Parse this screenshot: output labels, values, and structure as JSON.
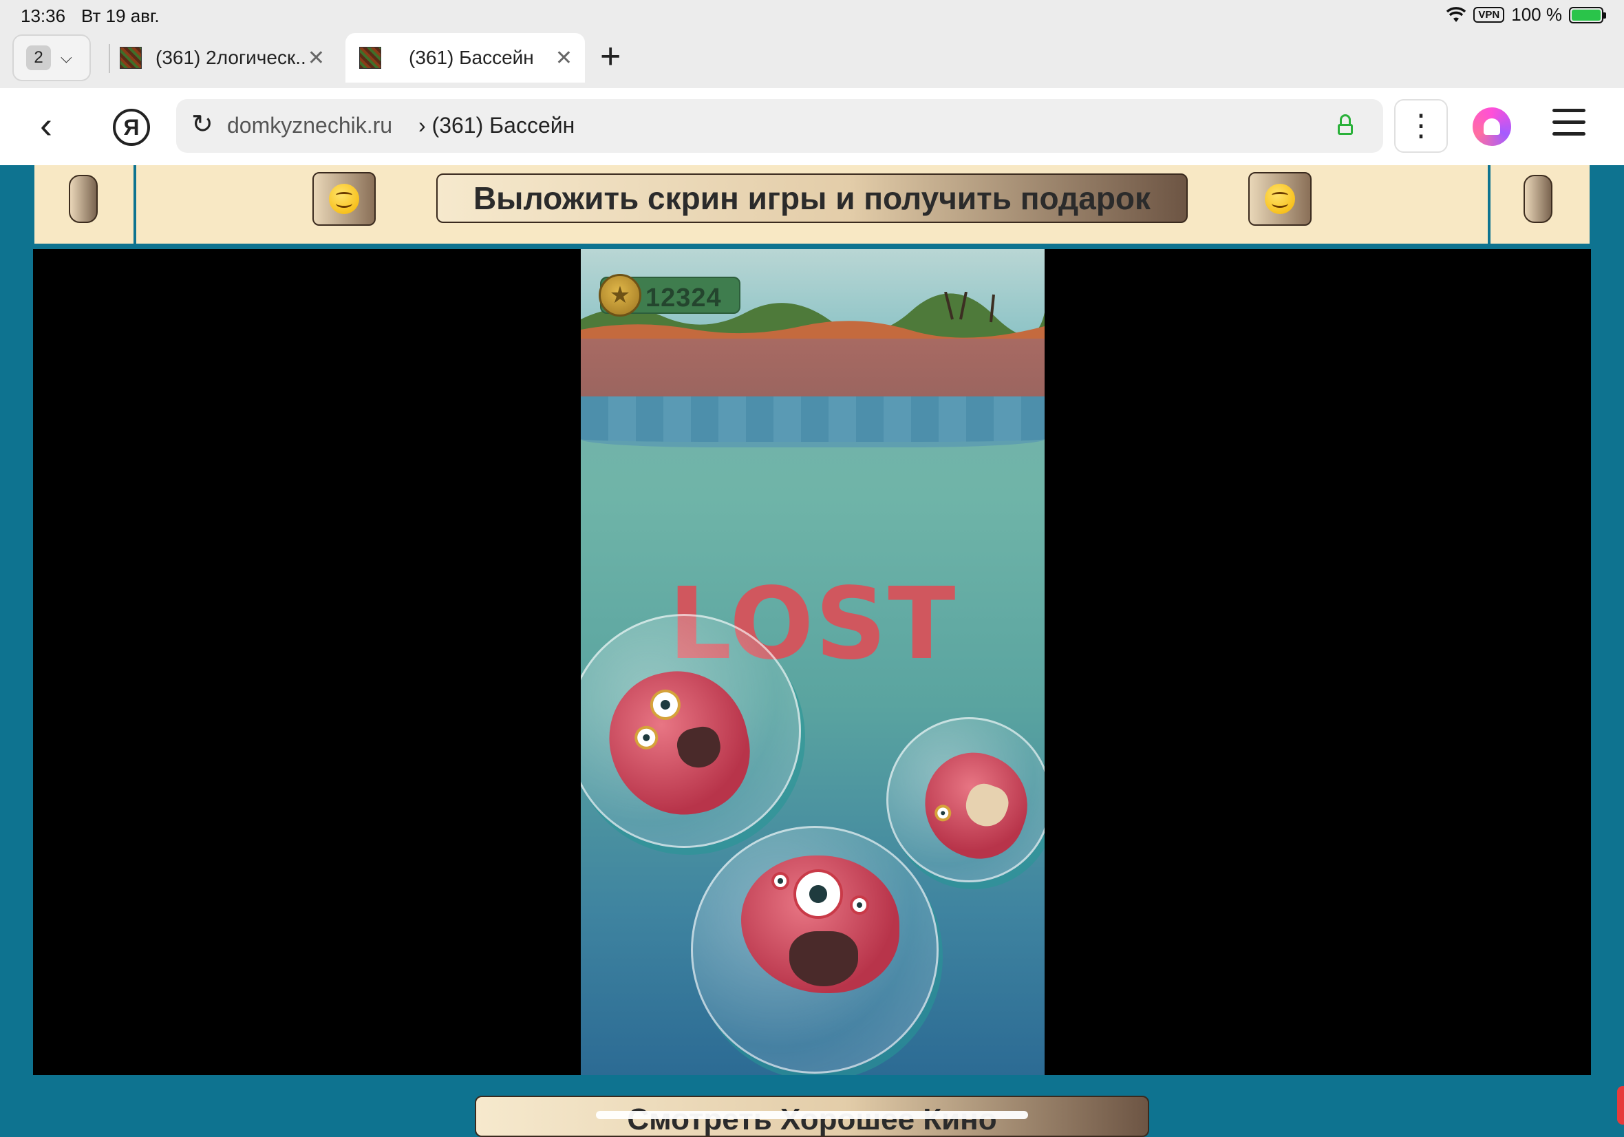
{
  "status_bar": {
    "time": "13:36",
    "date": "Вт 19 авг.",
    "vpn": "VPN",
    "battery": "100 %"
  },
  "tabs": {
    "count": "2",
    "items": [
      {
        "title": "(361) 2логическ...",
        "active": false
      },
      {
        "title": "(361) Бассейн",
        "active": true
      }
    ]
  },
  "address_bar": {
    "domain": "domkyznechik.ru",
    "separator": "›",
    "page_title": "(361) Бассейн",
    "browser_logo": "Я"
  },
  "banner": {
    "share_label": "Выложить скрин игры и получить подарок"
  },
  "game": {
    "score": "12324",
    "result_text": "LOST"
  },
  "footer": {
    "button_label": "Смотреть Хорошее Кино"
  },
  "icons": [
    "wifi-icon",
    "battery-icon",
    "chevron-down-icon",
    "close-icon",
    "plus-icon",
    "back-icon",
    "reload-icon",
    "lock-icon",
    "more-icon",
    "alice-icon",
    "hamburger-icon",
    "emoji-icon",
    "coin-icon"
  ],
  "colors": {
    "page_bg": "#0e7390",
    "banner_bg": "#f8e8c4",
    "lost_text": "#d0575e",
    "lock": "#2ab13a"
  }
}
